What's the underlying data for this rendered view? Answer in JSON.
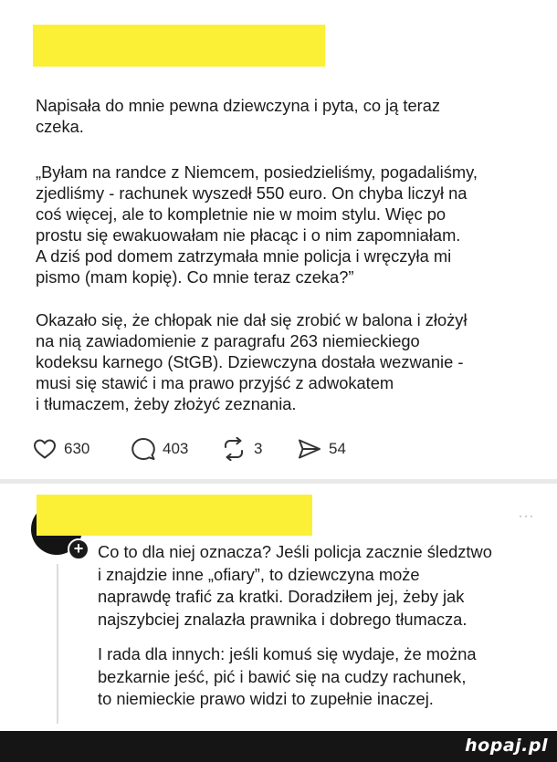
{
  "post": {
    "paragraphs": [
      "Napisała do mnie pewna dziewczyna i pyta, co ją teraz\nczeka.",
      "„Byłam na randce z Niemcem, posiedzieliśmy, pogadaliśmy,\nzjedliśmy - rachunek wyszedł 550 euro. On chyba liczył na\ncoś więcej, ale to kompletnie nie w moim stylu. Więc po\nprostu się ewakuowałam nie płacąc i o nim zapomniałam.\nA dziś pod domem zatrzymała mnie policja i wręczyła mi\npismo (mam kopię). Co mnie teraz czeka?”",
      "Okazało się, że chłopak nie dał się zrobić w balona i złożył\nna nią zawiadomienie z paragrafu 263 niemieckiego\nkodeksu karnego (StGB). Dziewczyna dostała wezwanie -\nmusi się stawić i ma prawo przyjść z adwokatem\ni tłumaczem, żeby złożyć zeznania."
    ],
    "actions": {
      "likes": "630",
      "comments": "403",
      "reposts": "3",
      "shares": "54"
    }
  },
  "reply": {
    "more_glyph": "···",
    "paragraphs": [
      "Co to dla niej oznacza? Jeśli policja zacznie śledztwo\ni znajdzie inne „ofiary”, to dziewczyna może\nnaprawdę trafić za kratki. Doradziłem jej, żeby jak\nnajszybciej znalazła prawnika i dobrego tłumacza.",
      "I rada dla innych: jeśli komuś się wydaje, że można\nbezkarnie jeść, pić i bawić się na cudzy rachunek,\nto niemieckie prawo widzi to zupełnie inaczej."
    ]
  },
  "footer": {
    "logo": "hopaj.pl"
  },
  "colors": {
    "redaction": "#fbf036",
    "footer_bg": "#151515"
  }
}
